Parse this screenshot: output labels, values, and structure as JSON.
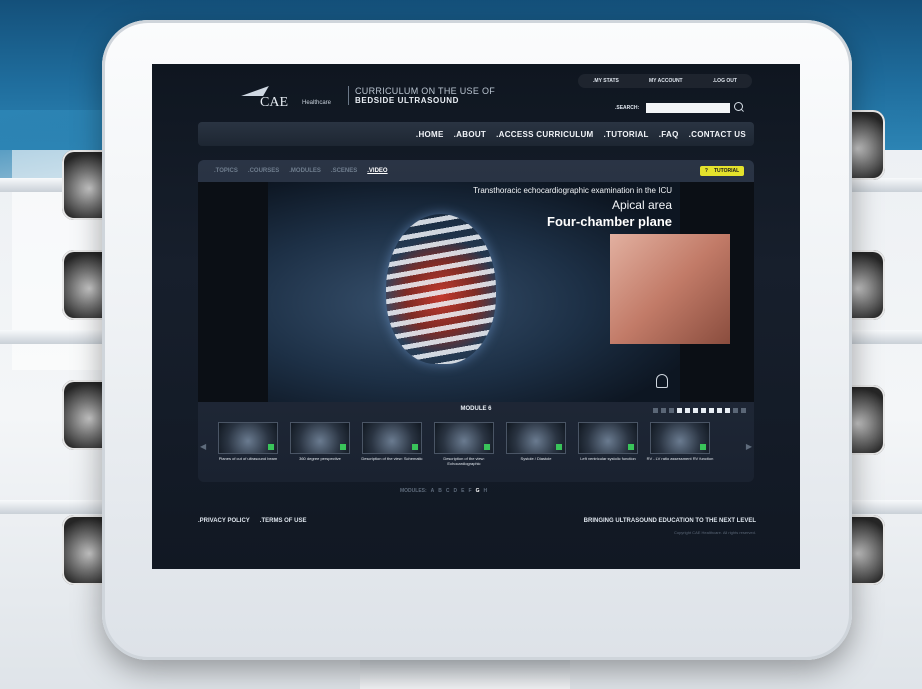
{
  "header": {
    "logo_text": "CAE",
    "logo_sub": "Healthcare",
    "title_line1": "CURRICULUM ON THE USE OF",
    "title_line2": "BEDSIDE ULTRASOUND"
  },
  "account": {
    "my_stats": ".MY STATS",
    "my_account": "MY ACCOUNT",
    "log_out": ".LOG OUT"
  },
  "search": {
    "label": ".SEARCH:",
    "value": ""
  },
  "nav": [
    ".HOME",
    ".ABOUT",
    ".ACCESS CURRICULUM",
    ".TUTORIAL",
    ".FAQ",
    ".CONTACT US"
  ],
  "tabs": [
    ".TOPICS",
    ".COURSES",
    ".MODULES",
    ".SCENES",
    ".VIDEO"
  ],
  "tutorial_button": {
    "icon": "?",
    "label": "TUTORIAL"
  },
  "video": {
    "line1": "Transthoracic echocardiographic examination in the ICU",
    "line2": "Apical area",
    "line3": "Four-chamber plane"
  },
  "module": {
    "title": "MODULE 6",
    "thumbnails": [
      "Planes of cut of ultrasound beam",
      "360 degree perspective",
      "Description of the view: Schematic",
      "Description of the view: Echocardiographic",
      "Systole / Diastole",
      "Left ventricular systolic function",
      "RV - LV ratio assessment RV function"
    ],
    "letters_label": "MODULES:",
    "letters": [
      "A",
      "B",
      "C",
      "D",
      "E",
      "F",
      "G",
      "H"
    ],
    "current_letter": "G"
  },
  "footer": {
    "privacy": ".PRIVACY POLICY",
    "terms": ".TERMS OF USE",
    "tagline": "BRINGING ULTRASOUND EDUCATION TO THE NEXT LEVEL",
    "copyright": "Copyright CAE Healthcare. All rights reserved."
  },
  "colors": {
    "screen_bg": "#111823",
    "tutorial_button": "#e4e22c",
    "accent_check": "#39c45a"
  }
}
